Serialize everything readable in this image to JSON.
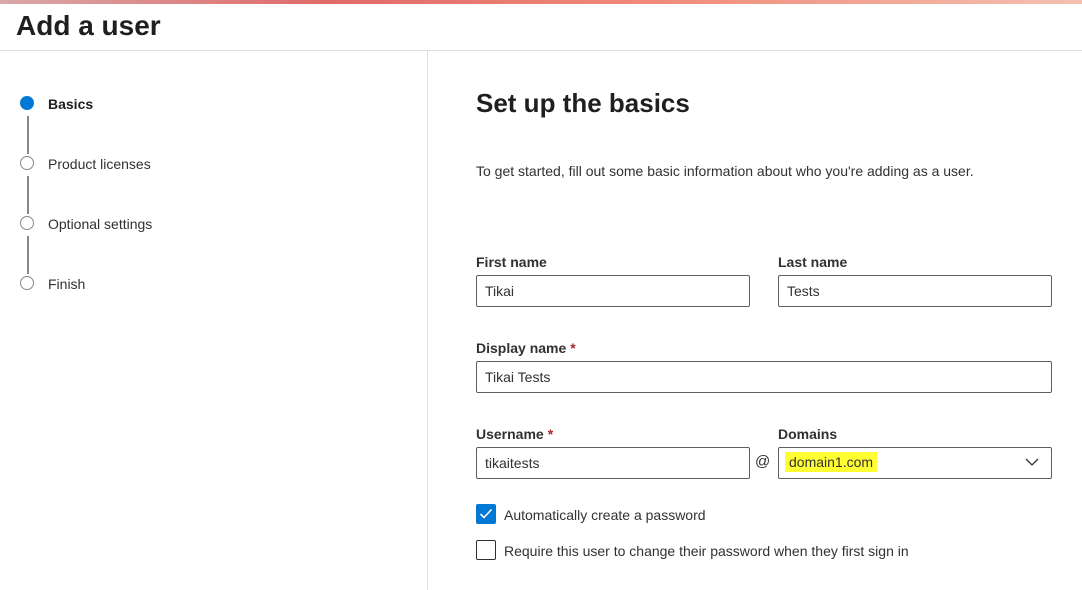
{
  "page": {
    "title": "Add a user"
  },
  "stepper": {
    "steps": [
      {
        "label": "Basics",
        "state": "active"
      },
      {
        "label": "Product licenses",
        "state": "pending"
      },
      {
        "label": "Optional settings",
        "state": "pending"
      },
      {
        "label": "Finish",
        "state": "pending"
      }
    ]
  },
  "form": {
    "title": "Set up the basics",
    "intro": "To get started, fill out some basic information about who you're adding as a user.",
    "first_name": {
      "label": "First name",
      "value": "Tikai"
    },
    "last_name": {
      "label": "Last name",
      "value": "Tests"
    },
    "display_name": {
      "label": "Display name",
      "required_mark": "*",
      "value": "Tikai Tests"
    },
    "username": {
      "label": "Username",
      "required_mark": "*",
      "value": "tikaitests"
    },
    "at_symbol": "@",
    "domains": {
      "label": "Domains",
      "value": "domain1.com",
      "highlight_color": "#ffff33"
    },
    "auto_password": {
      "label": "Automatically create a password",
      "checked": true
    },
    "require_change": {
      "label": "Require this user to change their password when they first sign in",
      "checked": false
    }
  },
  "colors": {
    "accent": "#0078d4",
    "required": "#a4262c"
  },
  "icons": {
    "chevron": "chevron-down-icon",
    "check": "checkmark-icon"
  }
}
